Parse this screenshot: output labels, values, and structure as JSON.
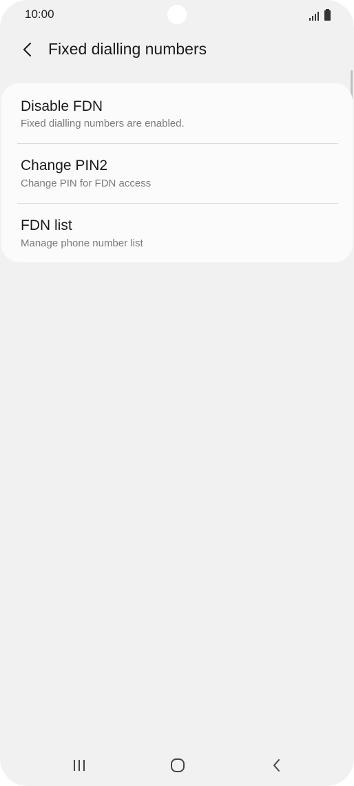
{
  "status_bar": {
    "time": "10:00"
  },
  "header": {
    "title": "Fixed dialling numbers",
    "back_icon": "chevron-left-icon"
  },
  "settings": {
    "items": [
      {
        "title": "Disable FDN",
        "subtitle": "Fixed dialling numbers are enabled."
      },
      {
        "title": "Change PIN2",
        "subtitle": "Change PIN for FDN access"
      },
      {
        "title": "FDN list",
        "subtitle": "Manage phone number list"
      }
    ]
  },
  "nav_bar": {
    "recents_icon": "recent-apps-icon",
    "home_icon": "home-icon",
    "back_icon": "back-icon"
  },
  "colors": {
    "background": "#f1f1f1",
    "card": "#fbfbfb",
    "title_text": "#1a1a1a",
    "subtitle_text": "#7a7a7a"
  }
}
